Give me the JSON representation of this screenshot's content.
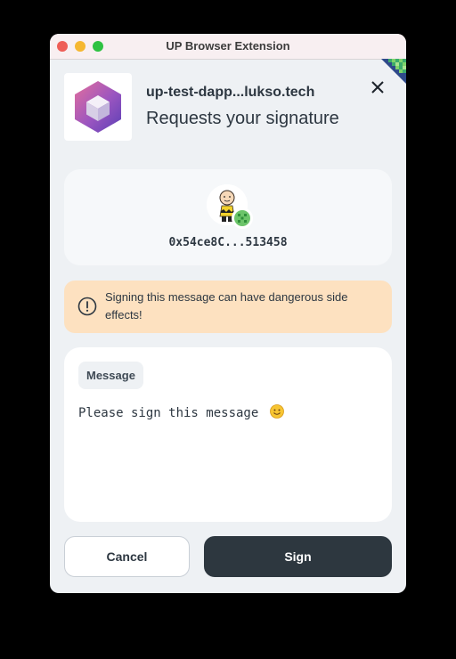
{
  "window": {
    "title": "UP Browser Extension"
  },
  "header": {
    "dapp_host": "up-test-dapp...lukso.tech",
    "request_title": "Requests your signature",
    "logo_icon": "hexagon-cube-icon",
    "close_icon": "close-icon"
  },
  "profile": {
    "address": "0x54ce8C...513458",
    "avatar_icon": "charlie-brown-avatar",
    "badge_icon": "identicon-badge"
  },
  "warning": {
    "icon": "exclamation-circle-icon",
    "text": "Signing this message can have dangerous side effects!"
  },
  "message": {
    "label": "Message",
    "body": "Please sign this message",
    "emoji_icon": "smiley-face-icon"
  },
  "actions": {
    "cancel_label": "Cancel",
    "sign_label": "Sign"
  },
  "colors": {
    "primary": "#2d373f",
    "warning_bg": "#fde1c0",
    "window_bg": "#eef1f4"
  }
}
